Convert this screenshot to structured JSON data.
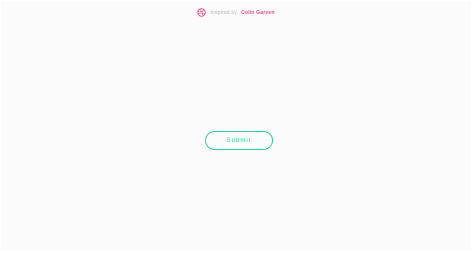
{
  "credit": {
    "prefix": "Inspired by",
    "author": "Colin Garven",
    "icon": "dribbble-icon",
    "accent": "#ea4c89"
  },
  "form": {
    "submit_label": "Submit",
    "accent": "#2fd19a"
  }
}
